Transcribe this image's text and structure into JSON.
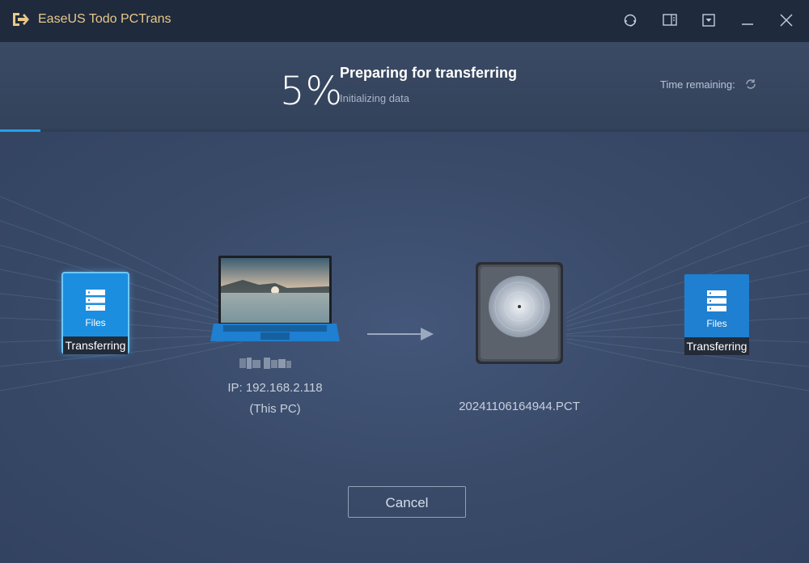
{
  "app": {
    "title": "EaseUS Todo PCTrans"
  },
  "window_controls": [
    {
      "name": "support-icon"
    },
    {
      "name": "feedback-icon"
    },
    {
      "name": "dropdown-menu-icon"
    },
    {
      "name": "minimize-icon"
    },
    {
      "name": "close-icon"
    }
  ],
  "progress": {
    "percent_text": "5%",
    "percent_value": 5,
    "title": "Preparing for transferring",
    "subtitle": "Initializing data",
    "time_remaining_label": "Time remaining:"
  },
  "source_tile": {
    "category": "Files",
    "status": "Transferring",
    "icon": "server-stack-icon"
  },
  "target_tile": {
    "category": "Files",
    "status": "Transferring",
    "icon": "server-stack-icon"
  },
  "source_pc": {
    "ip": "IP: 192.168.2.118",
    "note": "(This PC)"
  },
  "target_image": {
    "filename": "20241106164944.PCT",
    "icon": "disk-image-icon"
  },
  "actions": {
    "cancel_label": "Cancel"
  },
  "colors": {
    "accent": "#1fa2ef",
    "brand_title": "#e8c98a",
    "tile_blue": "#1b8ee0",
    "titlebar": "#1f2a3d"
  }
}
